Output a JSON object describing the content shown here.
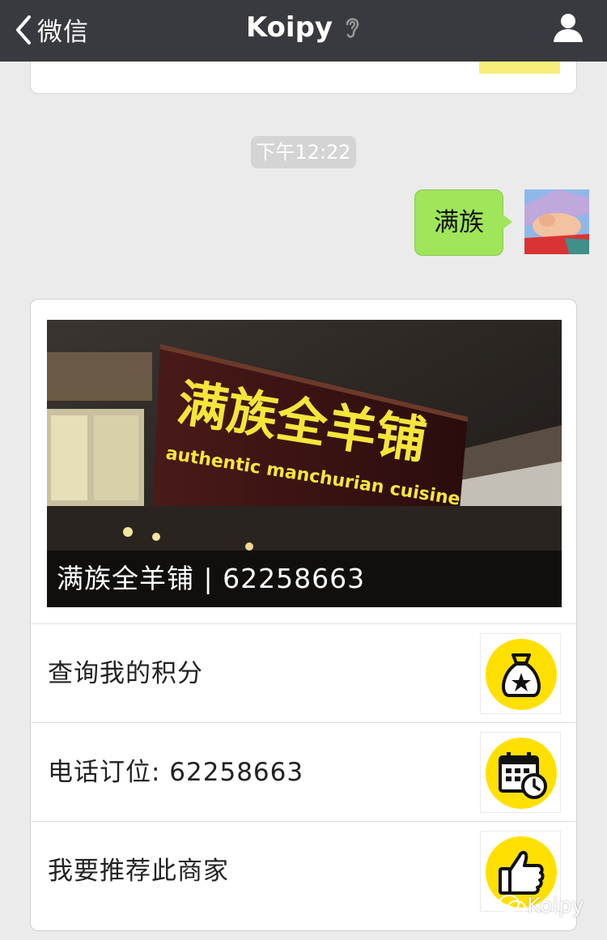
{
  "nav": {
    "back_label": "微信",
    "title": "Koipy",
    "back_icon": "chevron-left-icon",
    "title_icon": "ear-icon",
    "profile_icon": "person-icon"
  },
  "chat": {
    "timestamp": "下午12:22",
    "sent_message": "满族",
    "bubble_color": "#9fe65a"
  },
  "card": {
    "cover_sign_cn": "满族全羊铺",
    "cover_sign_en": "authentic manchurian cuisine",
    "cover_caption": "满族全羊铺 | 62258663",
    "menu": [
      {
        "label": "查询我的积分",
        "icon": "money-bag-star-icon"
      },
      {
        "label": "电话订位: 62258663",
        "icon": "calendar-clock-icon"
      },
      {
        "label": "我要推荐此商家",
        "icon": "thumbs-up-icon"
      }
    ],
    "accent": "#ffe000"
  },
  "watermark": "Koipy"
}
